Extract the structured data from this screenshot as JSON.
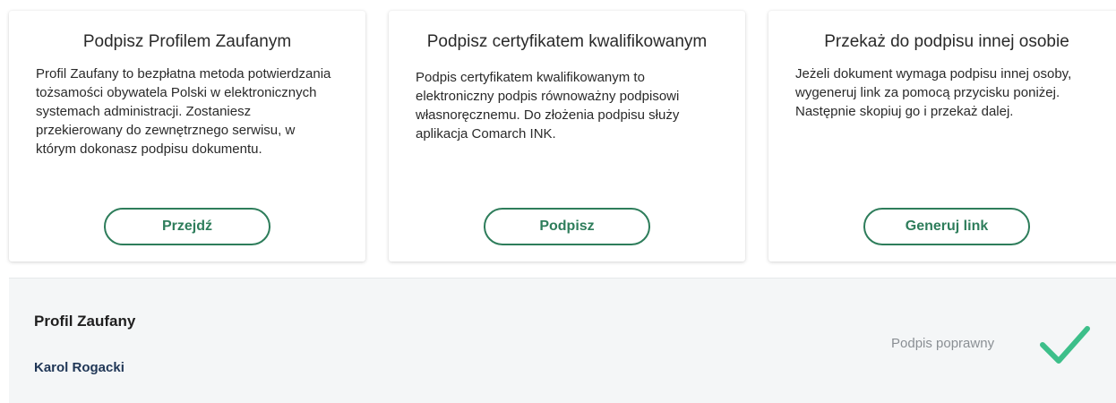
{
  "cards": [
    {
      "title": "Podpisz Profilem Zaufanym",
      "description": "Profil Zaufany to bezpłatna metoda potwierdzania tożsamości obywatela Polski w elektronicznych systemach administracji. Zostaniesz przekierowany do zewnętrznego serwisu, w którym dokonasz podpisu dokumentu.",
      "button_label": "Przejdź"
    },
    {
      "title": "Podpisz certyfikatem kwalifikowanym",
      "description": "Podpis certyfikatem kwalifikowanym to elektroniczny podpis równoważny podpisowi własnoręcznemu. Do złożenia podpisu służy aplikacja Comarch INK.",
      "button_label": "Podpisz"
    },
    {
      "title": "Przekaż do podpisu innej osobie",
      "description": "Jeżeli dokument wymaga podpisu innej osoby, wygeneruj link za pomocą przycisku poniżej. Następnie skopiuj go i przekaż dalej.",
      "button_label": "Generuj link"
    }
  ],
  "signature": {
    "method": "Profil Zaufany",
    "signer": "Karol Rogacki",
    "status": "Podpis poprawny",
    "status_icon": "check-icon"
  },
  "colors": {
    "accent": "#2e7d5b",
    "check": "#3dbf8a",
    "signer_text": "#1f3656",
    "panel_bg": "#f4f6f7"
  }
}
